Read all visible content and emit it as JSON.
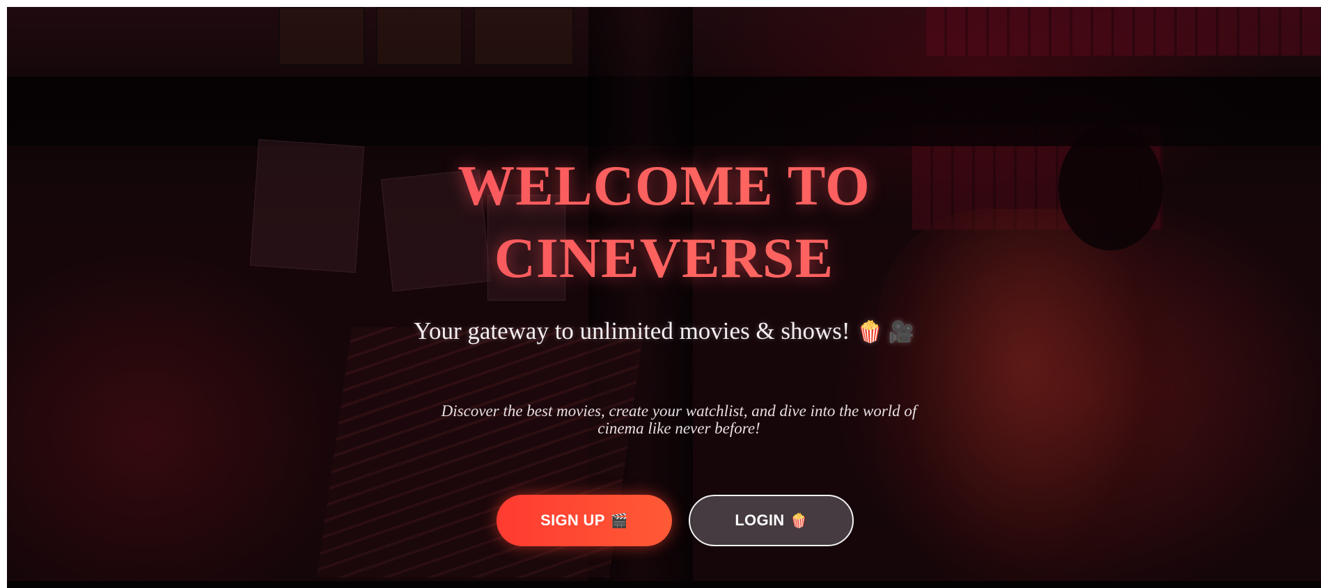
{
  "hero": {
    "title_line1": "WELCOME TO",
    "title_line2": "CINEVERSE",
    "tagline": "Your gateway to unlimited movies & shows!",
    "tagline_emojis": "🍿 🎥",
    "description": "Discover the best movies, create your watchlist, and dive into the world of cinema like never before!"
  },
  "buttons": {
    "signup_label": "SIGN UP",
    "signup_emoji": "🎬",
    "login_label": "LOGIN",
    "login_emoji": "🍿"
  },
  "colors": {
    "title": "#ff5a5f",
    "signup_bg": "#ff4433",
    "login_border": "#f2f2f2",
    "text": "#f4eef0"
  }
}
